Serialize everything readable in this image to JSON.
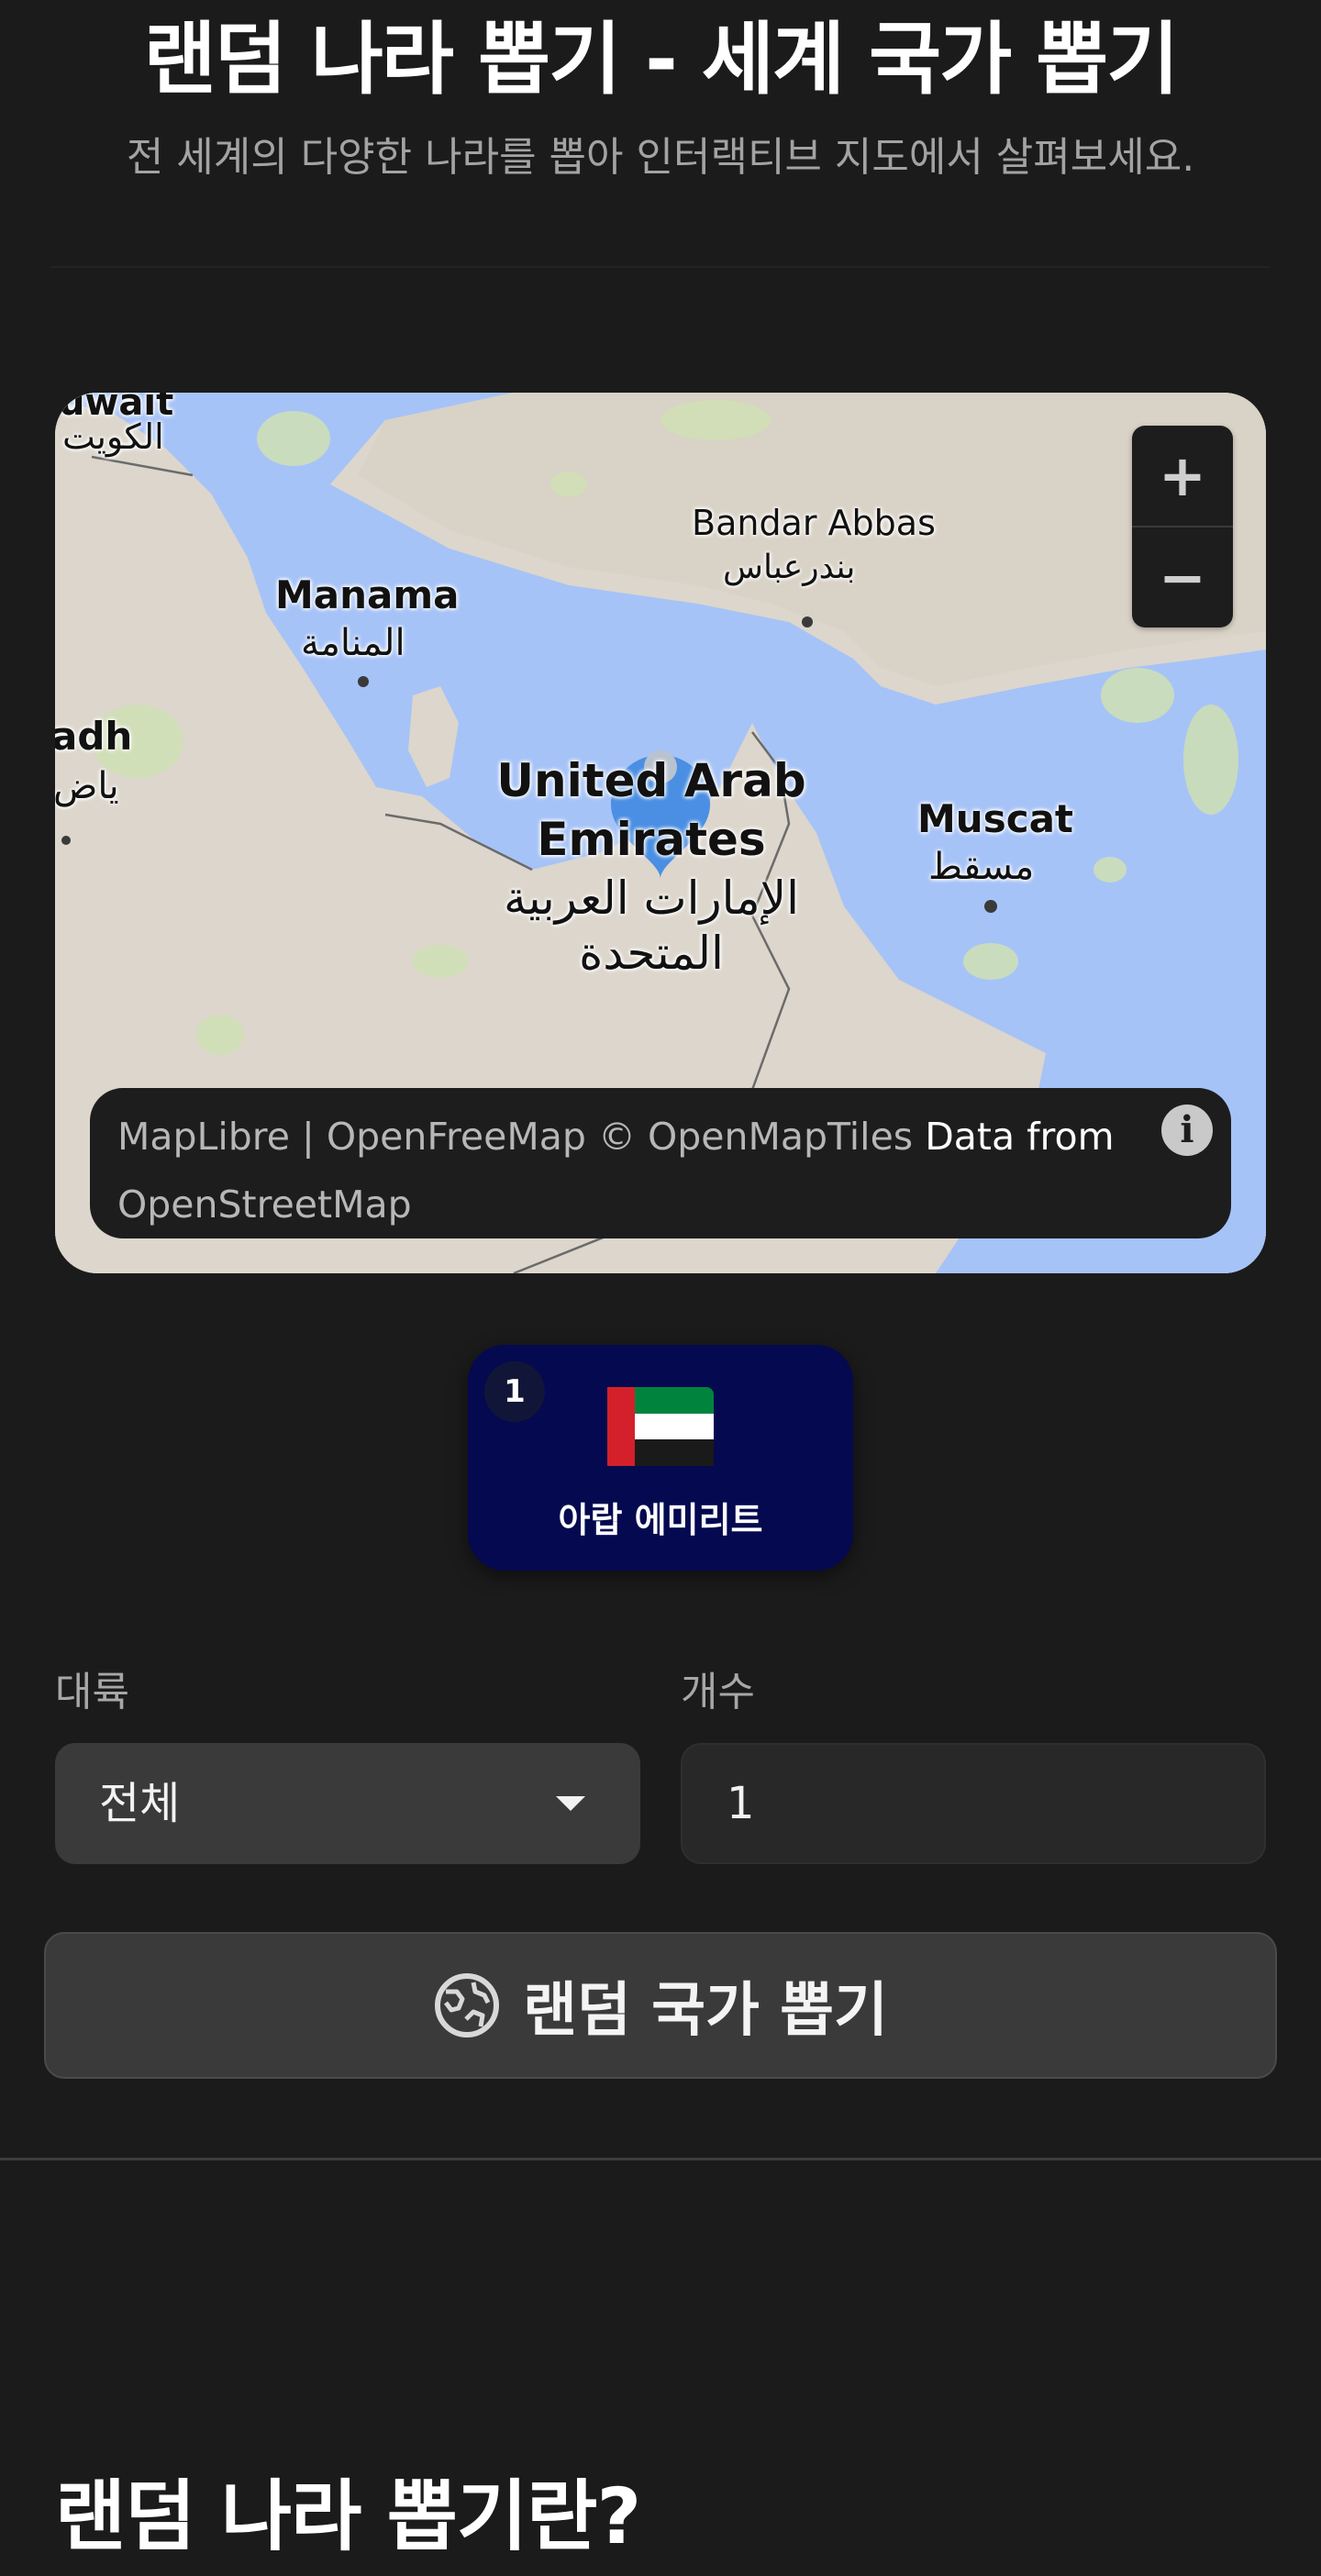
{
  "header": {
    "title": "랜덤 나라 뽑기 - 세계 국가 뽑기",
    "subtitle": "전 세계의 다양한 나라를 뽑아 인터랙티브 지도에서 살펴보세요."
  },
  "map": {
    "labels": {
      "kuwait_en": "uwait",
      "kuwait_ar": "الكويت",
      "manama_en": "Manama",
      "manama_ar": "المنامة",
      "riyadh_en": "adh",
      "riyadh_ar": "ياض",
      "bandar_en": "Bandar Abbas",
      "bandar_ar": "بندرعباس",
      "uae_en_1": "United Arab",
      "uae_en_2": "Emirates",
      "uae_ar_1": "الإمارات العربية",
      "uae_ar_2": "المتحدة",
      "muscat_en": "Muscat",
      "muscat_ar": "مسقط"
    },
    "zoom_in": "+",
    "zoom_out": "−",
    "attribution": {
      "maplibre": "MapLibre",
      "sep": " | ",
      "openfreemap": "OpenFreeMap",
      "omt": " © OpenMapTiles",
      "data_from": " Data from ",
      "osm": "OpenStreetMap"
    },
    "info": "i"
  },
  "result": {
    "index": "1",
    "country": "아랍 에미리트"
  },
  "form": {
    "continent_label": "대륙",
    "continent_value": "전체",
    "count_label": "개수",
    "count_value": "1",
    "pick_button": "랜덤 국가 뽑기"
  },
  "section": {
    "title": "랜덤 나라 뽑기란?"
  },
  "colors": {
    "background": "#1b1b1c",
    "card": "#05094f",
    "water": "#a6c3f7",
    "land": "#dcd6cc"
  }
}
